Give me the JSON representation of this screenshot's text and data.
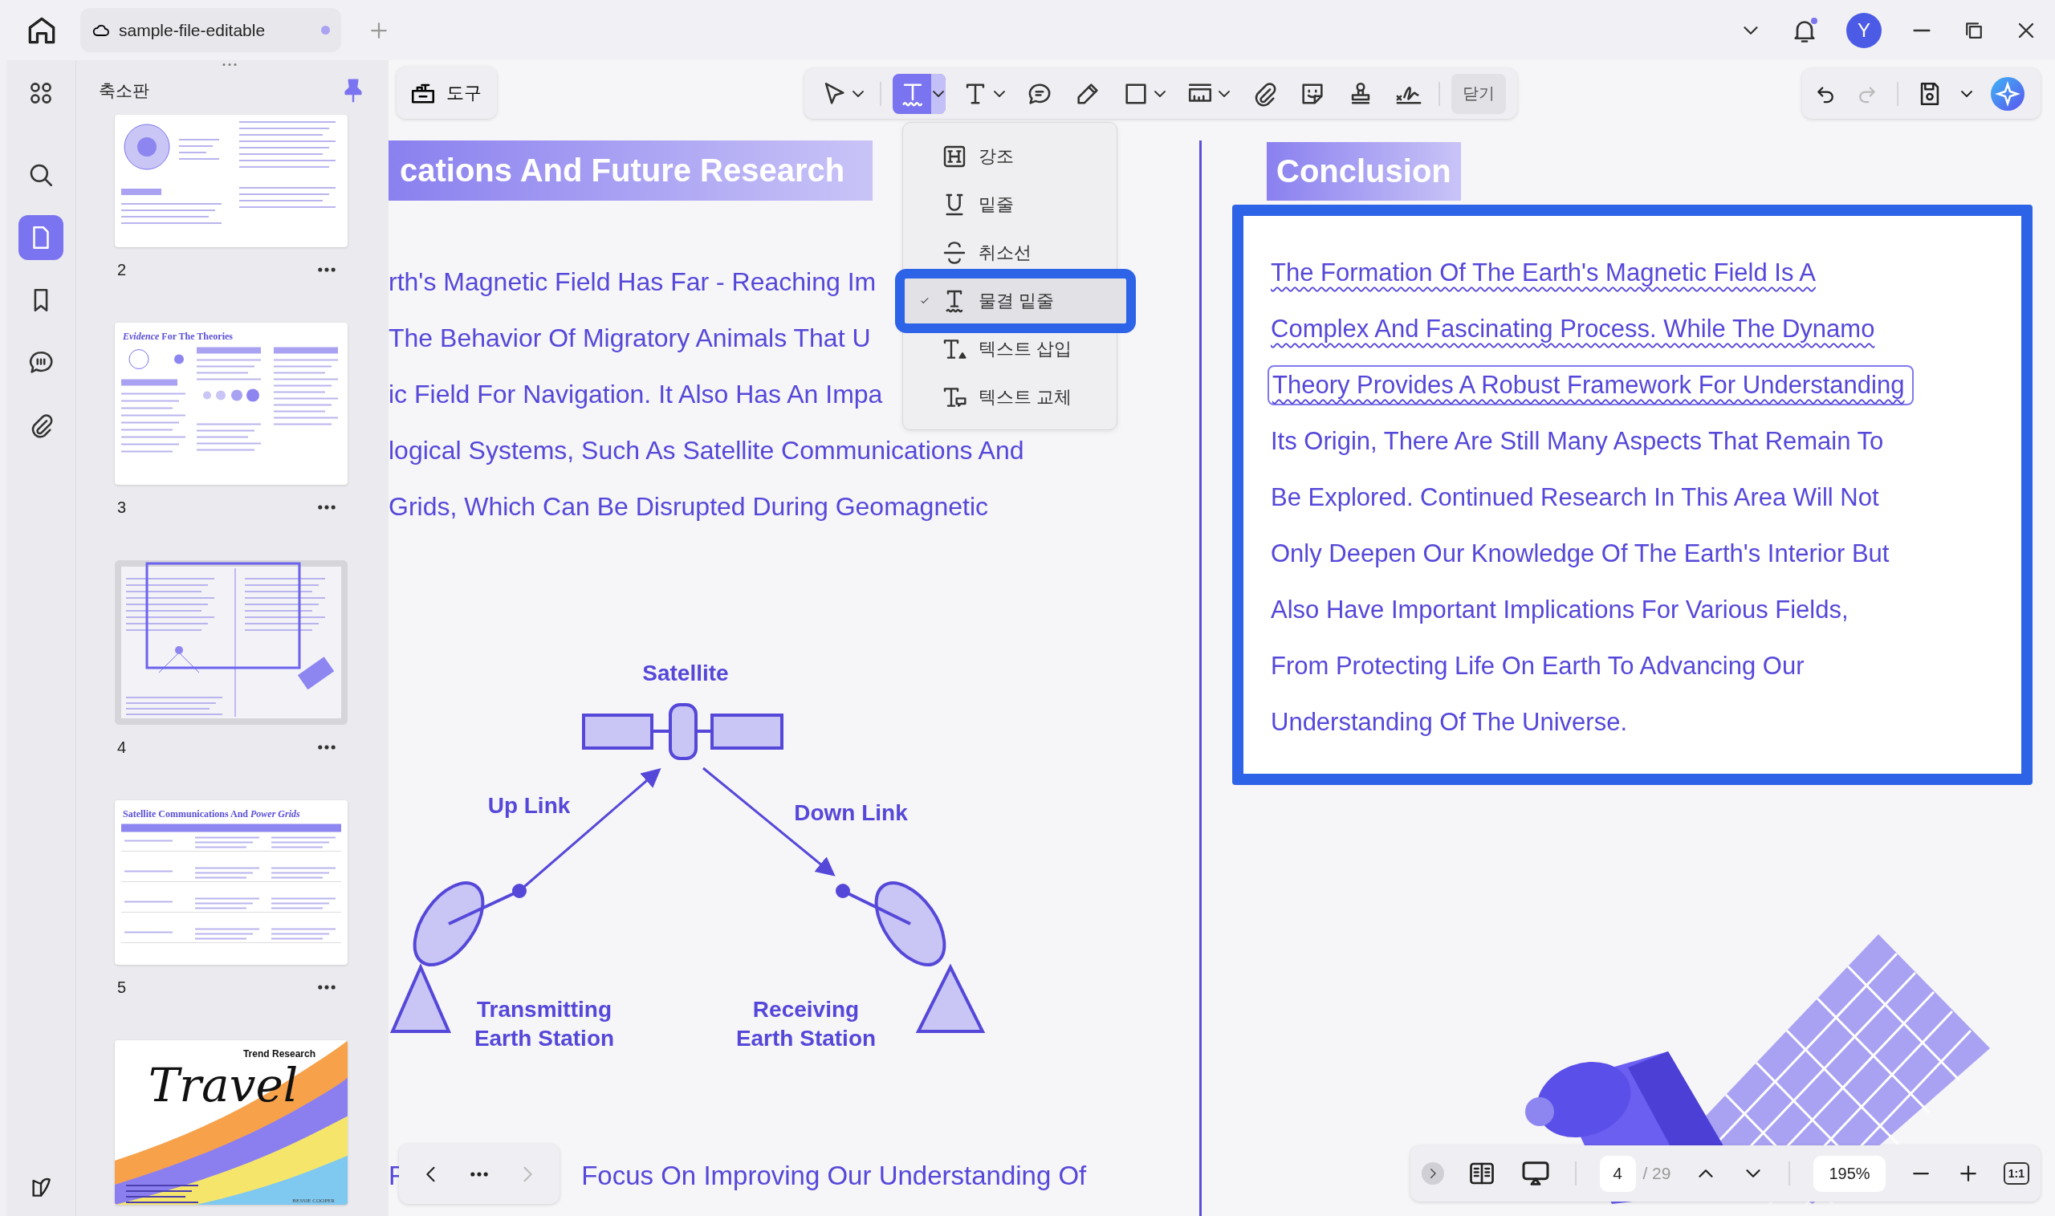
{
  "title_bar": {
    "tabs": [
      {
        "label": "sample-file-editable",
        "selected": true,
        "unsaved": true
      }
    ],
    "notification": true,
    "avatar": "Y"
  },
  "sidebar": {
    "items": [
      {
        "kind": "grid",
        "selected": false
      },
      {
        "kind": "search",
        "selected": false
      },
      {
        "kind": "thumbnails",
        "selected": true
      },
      {
        "kind": "bookmark",
        "selected": false
      },
      {
        "kind": "comments",
        "selected": false
      },
      {
        "kind": "attachments",
        "selected": false
      }
    ]
  },
  "thumbnail_panel": {
    "title": "축소판",
    "pinned": true,
    "pages": [
      {
        "kind": "diagram",
        "label": "2",
        "selected": false
      },
      {
        "kind": "chart",
        "label": "3",
        "selected": false,
        "title": "*Evidence* For The Theories"
      },
      {
        "kind": "spread",
        "label": "4",
        "selected": true
      },
      {
        "kind": "table",
        "label": "5",
        "selected": false,
        "title": "Satellite Communications And *Power Grids*"
      },
      {
        "kind": "cover",
        "selected": false,
        "title": "Travel",
        "subtitle": "Trend Research",
        "author": "BESSIE COOPER"
      }
    ]
  },
  "tools_button": "도구",
  "toolbar": {
    "tools": [
      {
        "kind": "select",
        "caret": true,
        "selected": false
      },
      {
        "kind": "squiggly",
        "caret": true,
        "selected": true
      },
      {
        "kind": "text",
        "caret": true,
        "selected": false
      },
      {
        "kind": "comment",
        "caret": false,
        "selected": false
      },
      {
        "kind": "pencil",
        "caret": false,
        "selected": false
      },
      {
        "kind": "shape",
        "caret": true,
        "selected": false
      },
      {
        "kind": "measure",
        "caret": true,
        "selected": false
      },
      {
        "kind": "attach",
        "caret": false,
        "selected": false
      },
      {
        "kind": "sticker",
        "caret": false,
        "selected": false
      },
      {
        "kind": "stamp",
        "caret": false,
        "selected": false
      },
      {
        "kind": "signature",
        "caret": false,
        "selected": false
      }
    ],
    "close": "닫기"
  },
  "history": {
    "undo_enabled": true,
    "redo_enabled": false
  },
  "markup_menu": {
    "items": [
      {
        "kind": "highlight",
        "label": "강조",
        "selected": false
      },
      {
        "kind": "underline",
        "label": "밑줄",
        "selected": false
      },
      {
        "kind": "strikeout",
        "label": "취소선",
        "selected": false
      },
      {
        "kind": "squiggly",
        "label": "물결 밑줄",
        "selected": true
      },
      {
        "kind": "insert",
        "label": "텍스트 삽입",
        "selected": false
      },
      {
        "kind": "replace",
        "label": "텍스트 교체",
        "selected": false
      }
    ]
  },
  "left_page": {
    "heading": "cations And Future Research",
    "lines": [
      "rth's Magnetic Field Has Far - Reaching Im",
      "The Behavior Of Migratory Animals That U",
      "ic Field For Navigation. It Also Has An Impa",
      "logical Systems, Such As Satellite Communications And",
      "Grids, Which Can Be Disrupted During Geomagnetic"
    ],
    "diagram": {
      "satellite": "Satellite",
      "uplink": "Up Link",
      "downlink": "Down Link",
      "transmitter": [
        "Transmitting",
        "Earth Station"
      ],
      "receiver": [
        "Receiving",
        "Earth Station"
      ]
    },
    "footer_left": "F",
    "footer_right": "Focus On Improving Our Understanding Of"
  },
  "right_page": {
    "heading": "Conclusion",
    "lines": [
      {
        "text": "The Formation Of The Earth's Magnetic Field Is A",
        "wavy": true,
        "boxed": false
      },
      {
        "text": "Complex And Fascinating Process. While The Dynamo",
        "wavy": true,
        "boxed": false
      },
      {
        "text": "Theory Provides A Robust Framework For Understanding",
        "wavy": true,
        "boxed": true
      },
      {
        "text": "Its Origin, There Are Still Many Aspects That Remain To",
        "wavy": false,
        "boxed": false
      },
      {
        "text": "Be Explored. Continued Research In This Area Will Not",
        "wavy": false,
        "boxed": false
      },
      {
        "text": "Only Deepen Our Knowledge Of The Earth's Interior But",
        "wavy": false,
        "boxed": false
      },
      {
        "text": "Also Have Important Implications For Various Fields,",
        "wavy": false,
        "boxed": false
      },
      {
        "text": "From Protecting Life On Earth To Advancing Our",
        "wavy": false,
        "boxed": false
      },
      {
        "text": "Understanding Of The Universe.",
        "wavy": false,
        "boxed": false
      }
    ]
  },
  "page_nav": {
    "prev_enabled": true,
    "next_enabled": false
  },
  "status_bar": {
    "page": "4",
    "total": "/ 29",
    "zoom": "195%",
    "fit_label": "1:1"
  }
}
